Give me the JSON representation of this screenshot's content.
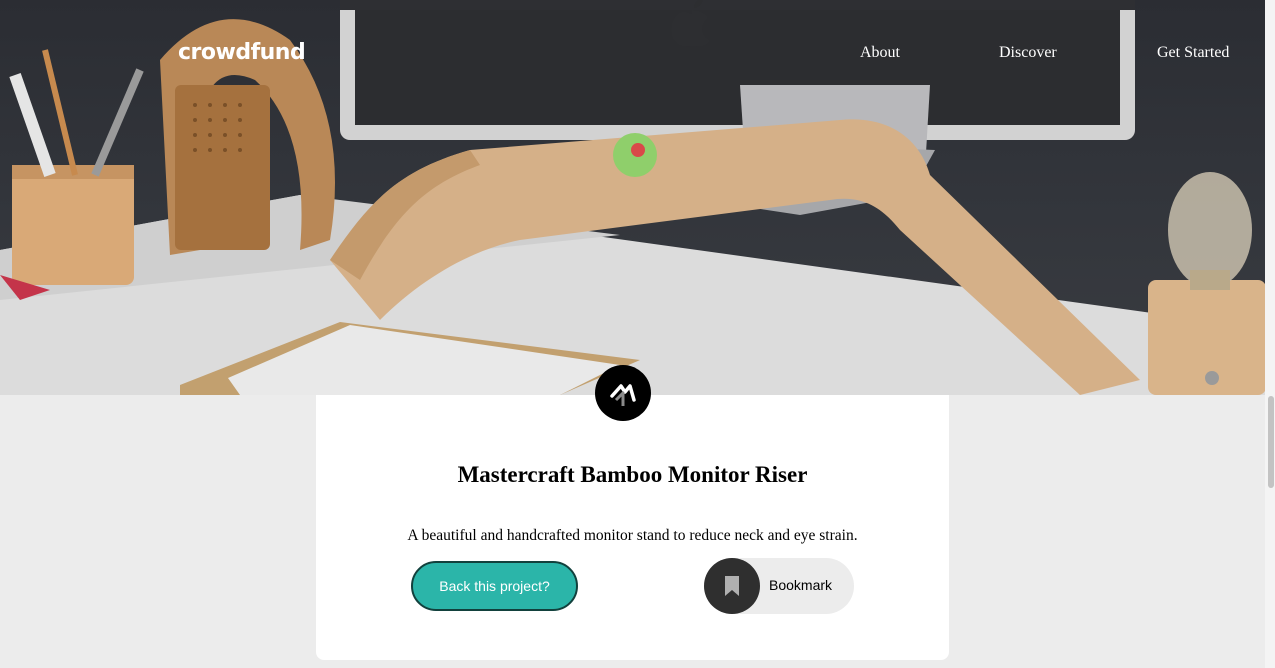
{
  "header": {
    "logo": "crowdfund",
    "nav": [
      "About",
      "Discover",
      "Get Started"
    ]
  },
  "hero": {
    "image_description_icon": "monitor-riser-desk-photo"
  },
  "project": {
    "brand_icon": "mastercraft-logo-icon",
    "title": "Mastercraft Bamboo Monitor Riser",
    "description": "A beautiful and handcrafted monitor stand to reduce neck and eye strain.",
    "back_label": "Back this project?",
    "bookmark_label": "Bookmark"
  },
  "colors": {
    "accent": "#2bb5a9",
    "accent_dark": "#12413d",
    "dark": "#2f2f2f",
    "background": "#ececec"
  }
}
